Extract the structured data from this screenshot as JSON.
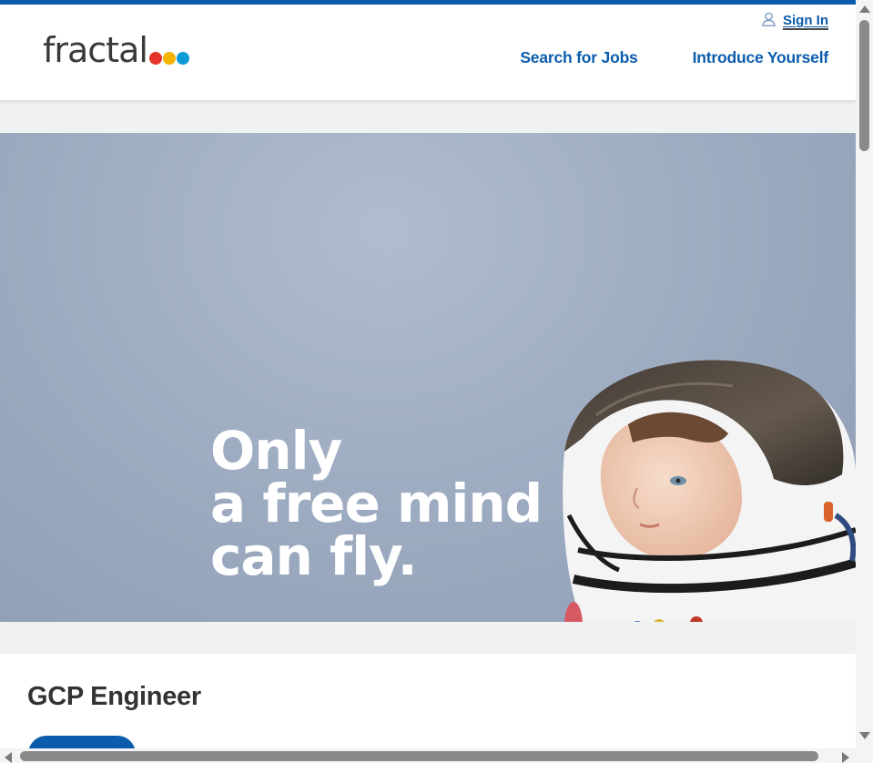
{
  "brand": {
    "logo_text": "fractal",
    "dot_colors": [
      "#e5352b",
      "#f4b400",
      "#0b9bd7"
    ],
    "accent_color": "#0b5cad"
  },
  "header": {
    "sign_in_label": "Sign In",
    "sign_in_icon": "user-icon",
    "nav": [
      {
        "label": "Search for Jobs"
      },
      {
        "label": "Introduce Yourself"
      }
    ]
  },
  "hero": {
    "line1": "Only",
    "line2": "a free mind",
    "line3": "can fly.",
    "image_alt": "child-in-astronaut-helmet"
  },
  "job": {
    "title": "GCP Engineer"
  }
}
